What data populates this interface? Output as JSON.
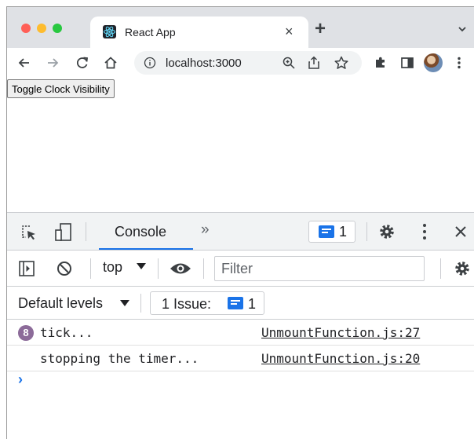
{
  "browser": {
    "tab": {
      "title": "React App",
      "favicon": "react-logo-icon",
      "close_glyph": "×"
    },
    "new_tab_glyph": "+",
    "address": {
      "url": "localhost:3000"
    }
  },
  "page": {
    "toggle_button_label": "Toggle Clock Visibility"
  },
  "devtools": {
    "tabs": {
      "console_label": "Console",
      "more_tabs_glyph": "»"
    },
    "issue_badge_count": "1",
    "context": "top",
    "filter_placeholder": "Filter",
    "levels_label": "Default levels",
    "issues_label": "1 Issue:",
    "issues_count": "1",
    "logs": [
      {
        "count": "8",
        "message": "tick...",
        "source": "UnmountFunction.js:27"
      },
      {
        "count": "",
        "message": "stopping the timer...",
        "source": "UnmountFunction.js:20"
      }
    ],
    "prompt_glyph": "›",
    "accent_color": "#1a73e8"
  }
}
